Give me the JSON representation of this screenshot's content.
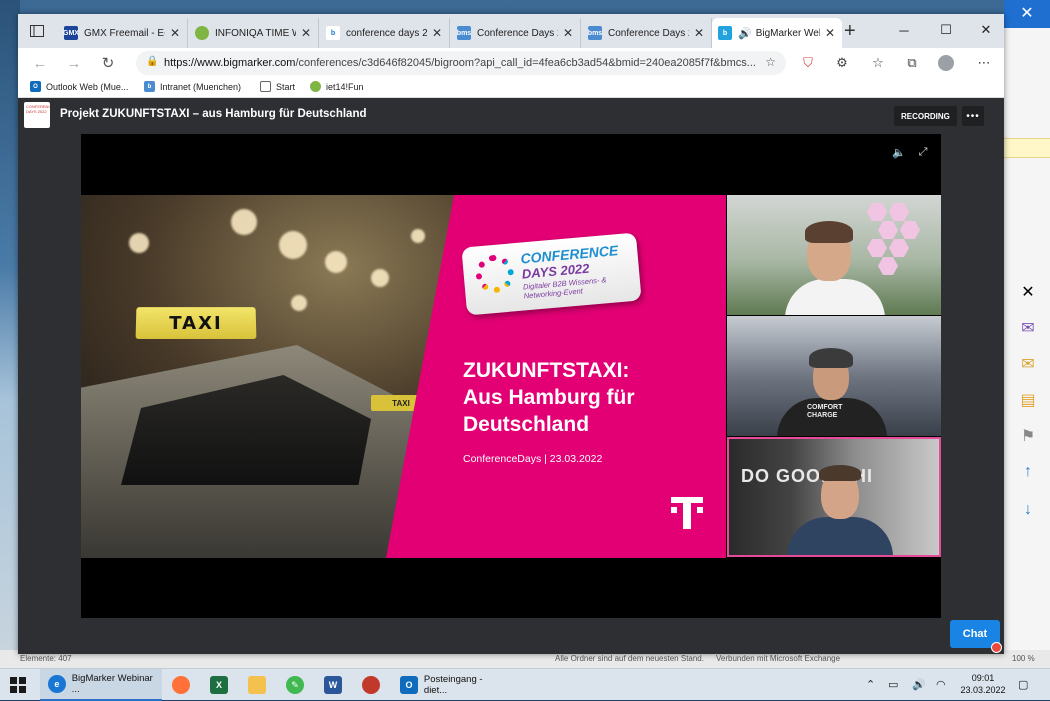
{
  "browser": {
    "tabs": [
      {
        "title": "GMX Freemail - E-M",
        "favicon": "gmx-icon",
        "active": false
      },
      {
        "title": "INFONIQA TIME We",
        "favicon": "clock-icon",
        "active": false
      },
      {
        "title": "conference days 20",
        "favicon": "bing-icon",
        "active": false
      },
      {
        "title": "Conference Days 20",
        "favicon": "conference-icon",
        "active": false
      },
      {
        "title": "Conference Days 20",
        "favicon": "conference-icon",
        "active": false
      },
      {
        "title": "BigMarker Web",
        "favicon": "bigmarker-icon",
        "active": true
      }
    ],
    "new_tab_label": "+",
    "url_host": "https://www.bigmarker.com",
    "url_path": "/conferences/c3d646f82045/bigroom?api_call_id=4fea6cb3ad54&bmid=240ea2085f7f&bmcs...",
    "bookmarks": [
      {
        "label": "Outlook Web (Mue...",
        "icon": "outlook-icon"
      },
      {
        "label": "Intranet (Muenchen)",
        "icon": "intranet-icon"
      },
      {
        "label": "Start",
        "icon": "page-icon"
      },
      {
        "label": "iet14!Fun",
        "icon": "clock-icon"
      }
    ]
  },
  "webinar": {
    "logo_text": "CONFERENCE DAYS 2022",
    "title": "Projekt ZUKUNFTSTAXI – aus Hamburg für Deutschland",
    "recording_label": "RECORDING",
    "more_label": "•••",
    "chat_label": "Chat"
  },
  "slide": {
    "taxi_sign": "TAXI",
    "logo_line1": "CONFERENCE",
    "logo_line2": "DAYS 2022",
    "logo_line3": "Digitaler B2B Wissens- & Networking-Event",
    "headline_line1": "ZUKUNFTSTAXI:",
    "headline_line2": "Aus Hamburg für",
    "headline_line3": "Deutschland",
    "subline": "ConferenceDays | 23.03.2022",
    "brand_mark": "T"
  },
  "cameras": [
    {
      "label": "speaker-1",
      "active": false
    },
    {
      "label": "speaker-2",
      "active": false,
      "shirt_text": "COMFORT CHARGE"
    },
    {
      "label": "speaker-3",
      "active": true,
      "wall_text": "DO GOOD THI"
    }
  ],
  "outlook_status": {
    "items": "Elemente: 407",
    "folders": "Alle Ordner sind auf dem neuesten Stand.",
    "connection": "Verbunden mit Microsoft Exchange",
    "zoom": "100 %"
  },
  "taskbar": {
    "apps": [
      {
        "label": "BigMarker Webinar ...",
        "icon": "edge-icon",
        "active": true
      },
      {
        "label": "",
        "icon": "firefox-icon"
      },
      {
        "label": "",
        "icon": "excel-icon"
      },
      {
        "label": "",
        "icon": "explorer-icon"
      },
      {
        "label": "",
        "icon": "pen-icon"
      },
      {
        "label": "",
        "icon": "word-icon"
      },
      {
        "label": "",
        "icon": "burn-icon"
      },
      {
        "label": "Posteingang - diet...",
        "icon": "outlook-icon",
        "active": false
      }
    ],
    "time": "09:01",
    "date": "23.03.2022"
  },
  "colors": {
    "magenta": "#e20074",
    "chat_blue": "#1a84e5",
    "active_cam_border": "#e44c9a"
  }
}
